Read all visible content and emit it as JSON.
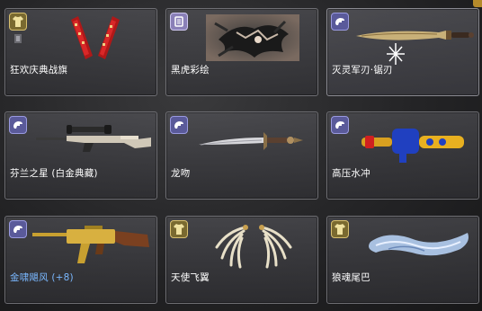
{
  "items": [
    {
      "label": "狂欢庆典战旗",
      "label_color": "#ffffff",
      "badge_type": "gold",
      "icon": "banner-icon"
    },
    {
      "label": "黑虎彩绘",
      "label_color": "#ffffff",
      "badge_type": "lavender",
      "icon": "spray-icon"
    },
    {
      "label": "灭灵军刃·锯刃",
      "label_color": "#ffffff",
      "badge_type": "blue",
      "icon": "dagger-icon"
    },
    {
      "label": "芬兰之星 (白金典藏)",
      "label_color": "#ffffff",
      "badge_type": "blue",
      "icon": "sniper-rifle-icon"
    },
    {
      "label": "龙吻",
      "label_color": "#ffffff",
      "badge_type": "blue",
      "icon": "sword-icon"
    },
    {
      "label": "高压水冲",
      "label_color": "#ffffff",
      "badge_type": "blue",
      "icon": "water-gun-icon"
    },
    {
      "label": "金啸飓风 (+8)",
      "label_color": "#7ab8ff",
      "badge_type": "blue",
      "icon": "rifle-icon"
    },
    {
      "label": "天使飞翼",
      "label_color": "#ffffff",
      "badge_type": "gold",
      "icon": "wings-icon"
    },
    {
      "label": "狼魂尾巴",
      "label_color": "#ffffff",
      "badge_type": "gold",
      "icon": "tail-icon"
    }
  ],
  "colors": {
    "badge_blue": "#5a5a9a",
    "badge_gold": "#7a6a30",
    "badge_lavender": "#8a80b8",
    "label_highlight": "#7ab8ff"
  }
}
